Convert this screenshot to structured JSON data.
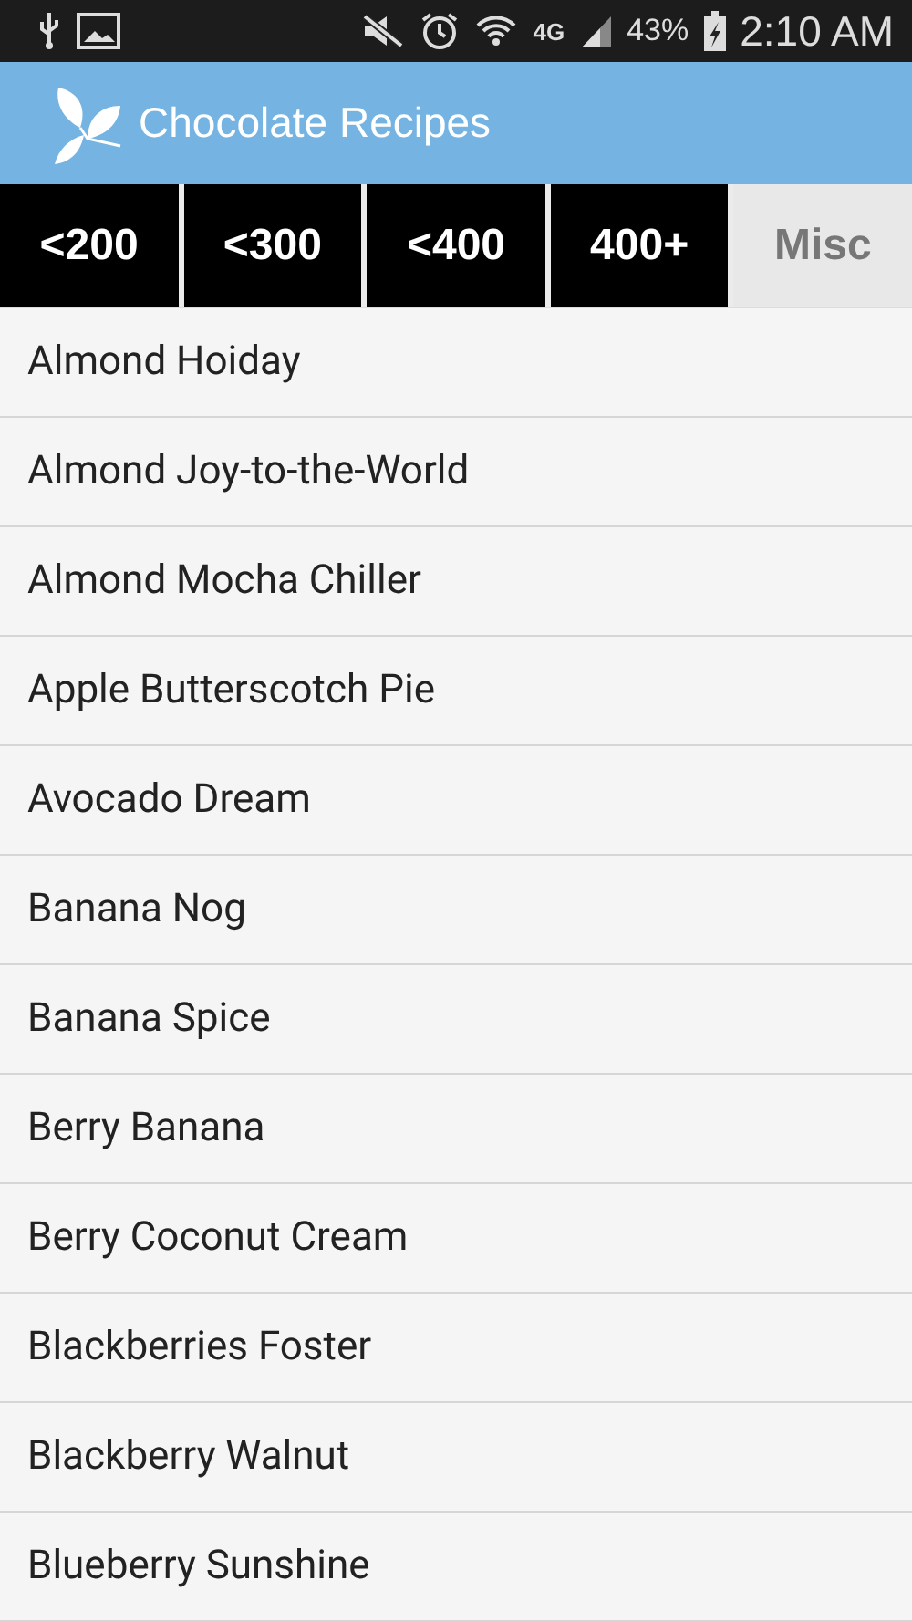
{
  "status_bar": {
    "network": "4G",
    "battery": "43%",
    "time": "2:10 AM"
  },
  "app_bar": {
    "title": "Chocolate Recipes"
  },
  "tabs": [
    {
      "label": "<200",
      "selected": false
    },
    {
      "label": "<300",
      "selected": false
    },
    {
      "label": "<400",
      "selected": false
    },
    {
      "label": "400+",
      "selected": false
    },
    {
      "label": "Misc",
      "selected": true
    }
  ],
  "recipes": [
    "Almond Hoiday",
    "Almond Joy-to-the-World",
    "Almond Mocha Chiller",
    "Apple Butterscotch Pie",
    "Avocado Dream",
    "Banana Nog",
    "Banana Spice",
    "Berry Banana",
    "Berry Coconut Cream",
    "Blackberries Foster",
    "Blackberry Walnut",
    "Blueberry Sunshine"
  ]
}
